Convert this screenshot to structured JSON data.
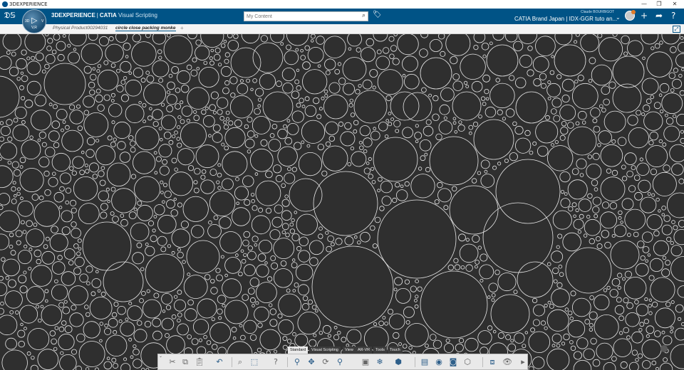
{
  "window": {
    "title": "3DEXPERIENCE",
    "minimize": "—",
    "maximize": "❐",
    "close": "✕"
  },
  "topbar": {
    "brand": "3DEXPERIENCE",
    "separator": "|",
    "app": "CATIA",
    "app_role": "Visual Scripting",
    "compass_label": "V,R",
    "compass_3d": "3D",
    "compass_v": "V",
    "search_placeholder": "My Content",
    "search_icon": "magnifier",
    "user": "Claude BOURBIGOT",
    "tenant": "CATIA Brand Japan | IDX-GGR tuto an...",
    "icons": [
      "tag-icon",
      "avatar",
      "plus-icon",
      "share-icon",
      "help-icon"
    ],
    "accent": "#005386"
  },
  "tabs": [
    {
      "label": "Physical Product00294031",
      "active": false
    },
    {
      "label": "circle close packing monke",
      "active": true
    }
  ],
  "tab_add": "+",
  "viewport": {
    "background": "#2f2f2f",
    "stroke": "#e8e8e8"
  },
  "action_bar": {
    "sections": [
      "Standard",
      "Visual Scripting",
      "View",
      "AR-VR",
      "Tools",
      "Touch"
    ],
    "active_section": "Standard",
    "tools": [
      "cut-icon",
      "copy-icon",
      "paste-icon",
      "undo-icon",
      "zoom-area-icon",
      "select-icon",
      "help-icon",
      "zoom-icon",
      "pan-icon",
      "rotate-icon",
      "zoom-fit-icon",
      "capture-icon",
      "sections-icon",
      "view-cube-icon",
      "render-icon",
      "material-icon",
      "camera-icon",
      "display-icon",
      "snapshot-icon",
      "visibility-icon"
    ]
  }
}
